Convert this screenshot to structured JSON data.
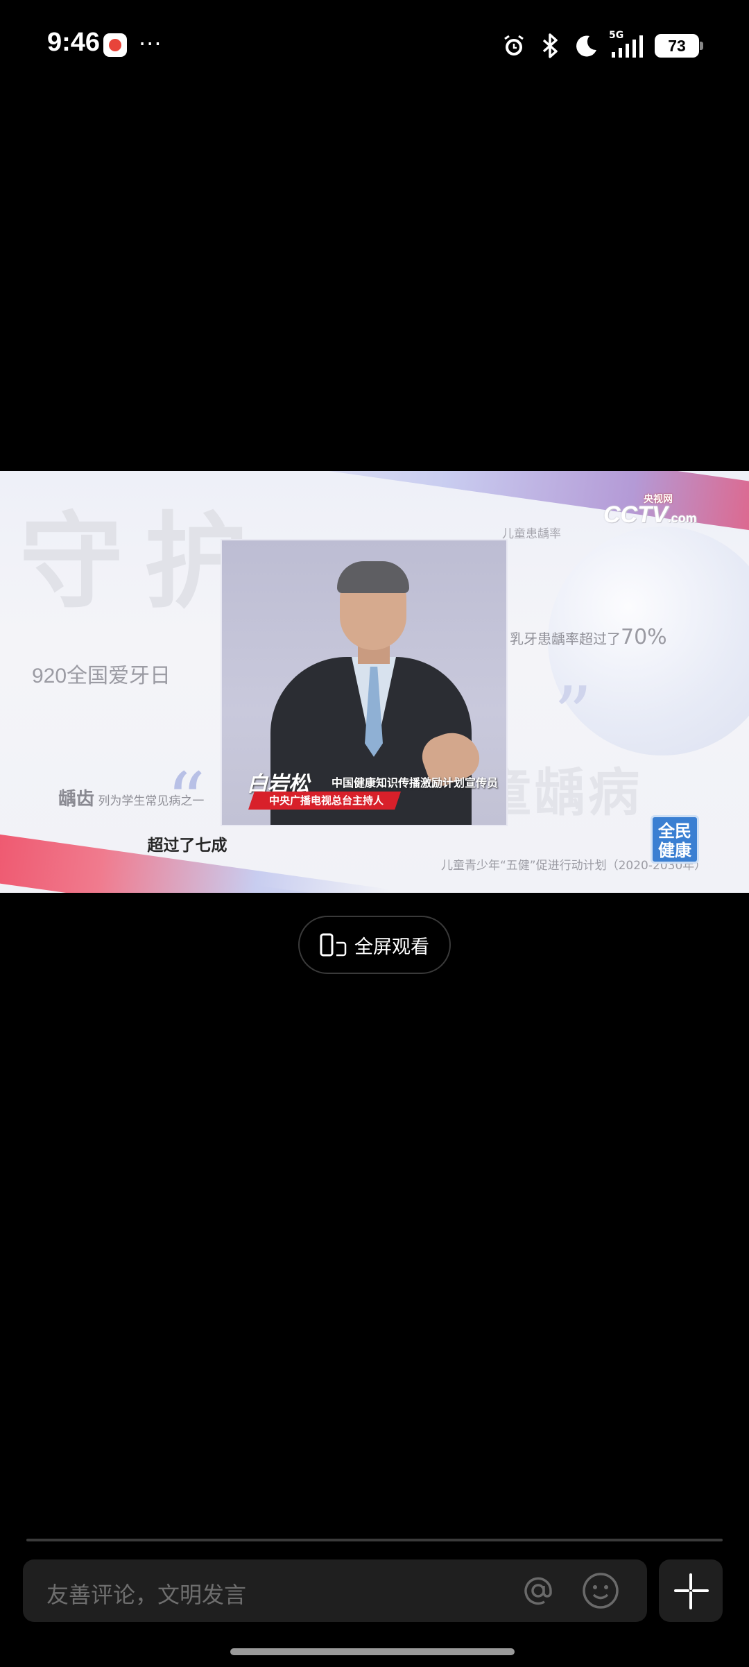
{
  "status_bar": {
    "time": "9:46",
    "more": "···",
    "network": "5G",
    "battery": "73"
  },
  "video": {
    "bg_title": "守护",
    "bg_title2": "童龋病",
    "slogan": "920全国爱牙日",
    "annotation_rate": "儿童患龋率",
    "annotation_milk_prefix": "乳牙患龋率超过了",
    "annotation_milk_number": "70%",
    "annotation_cav_bold": "龋齿",
    "annotation_cav_rest": "列为学生常见病之一",
    "logo_brand": "CCTV",
    "logo_site": ".com",
    "logo_cn": "央视网",
    "plan": "儿童青少年“五健”促进行动计划（2020-2030年）",
    "badge_line1": "全民",
    "badge_line2": "健康",
    "presenter_name": "白岩松",
    "presenter_role": "中国健康知识传播激励计划宣传员",
    "presenter_org": "中央广播电视总台主持人",
    "subtitle": "超过了七成"
  },
  "fullscreen_button": {
    "label": "全屏观看",
    "icon": "phone-rotate-icon"
  },
  "comment_bar": {
    "placeholder": "友善评论，文明发言",
    "at_icon": "at-icon",
    "emoji_icon": "smile-icon",
    "more_icon": "sparkle-icon"
  }
}
